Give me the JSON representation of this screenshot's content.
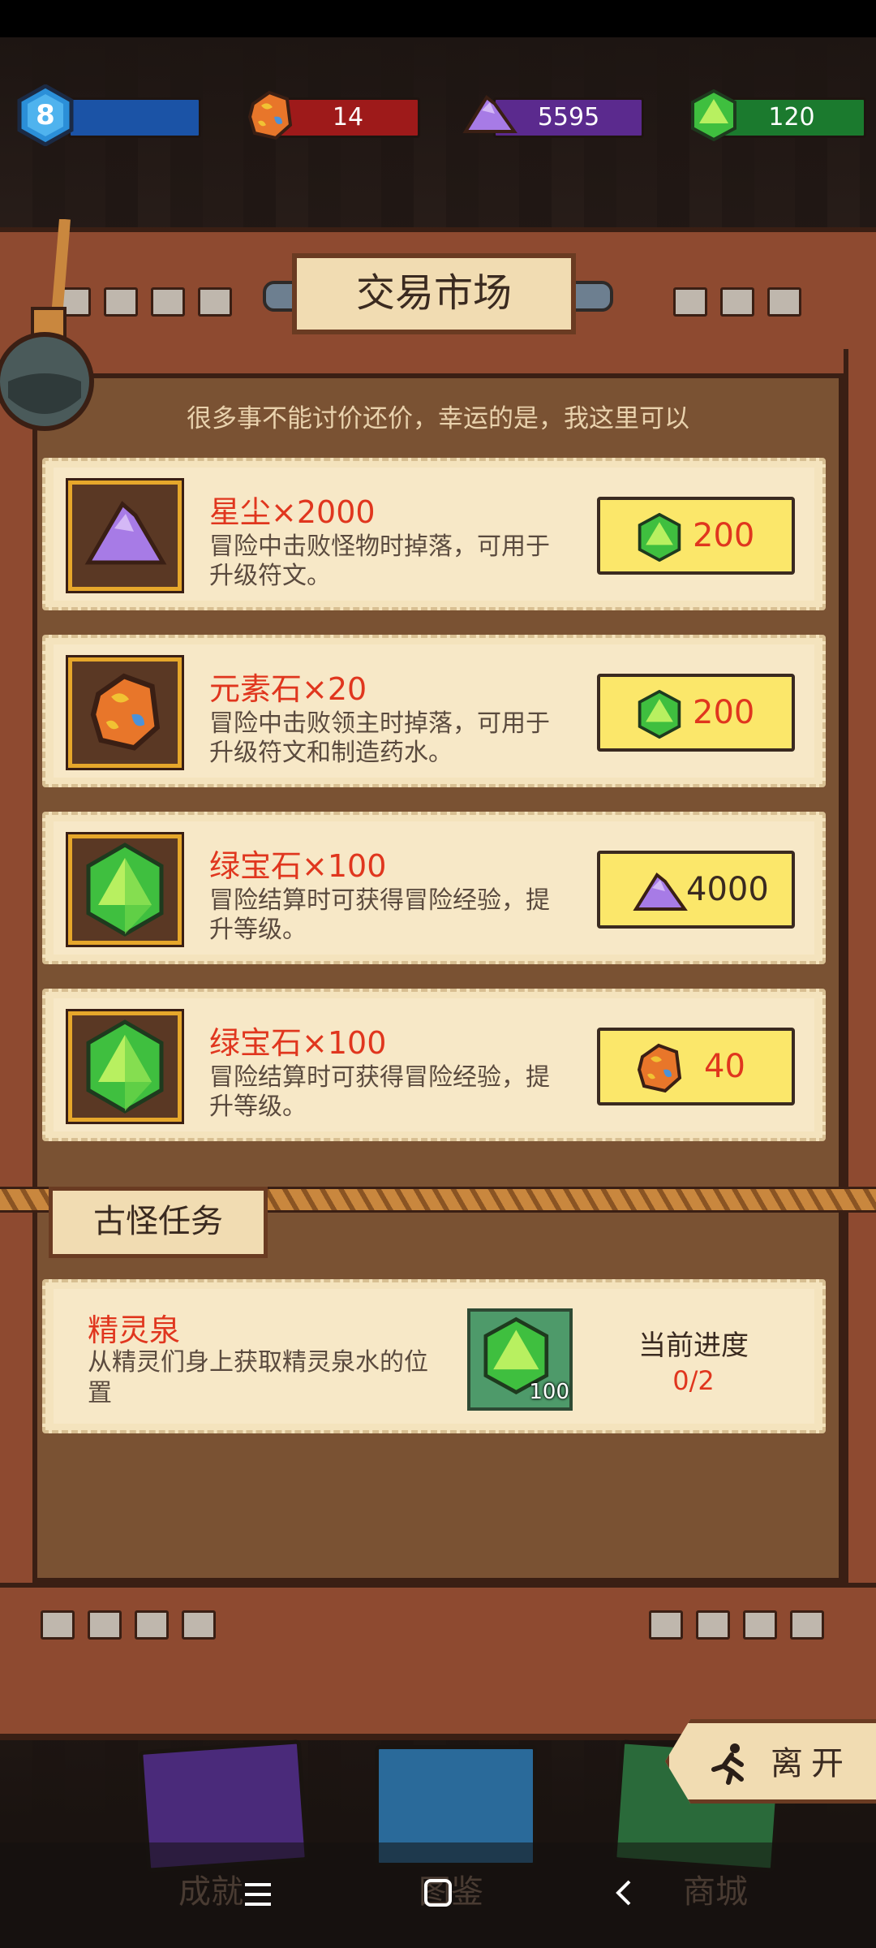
{
  "top_bar": {
    "level": "8",
    "element_stones": "14",
    "stardust": "5595",
    "emeralds": "120"
  },
  "market": {
    "title": "交易市场",
    "subtitle": "很多事不能讨价还价，幸运的是，我这里可以",
    "items": [
      {
        "name": "星尘×2000",
        "desc_1": "冒险中击败怪物时掉落，可用于",
        "desc_2": "升级符文。",
        "price": "200"
      },
      {
        "name": "元素石×20",
        "desc_1": "冒险中击败领主时掉落，可用于",
        "desc_2": "升级符文和制造药水。",
        "price": "200"
      },
      {
        "name": "绿宝石×100",
        "desc_1": "冒险结算时可获得冒险经验，提",
        "desc_2": "升等级。",
        "price": "4000"
      },
      {
        "name": "绿宝石×100",
        "desc_1": "冒险结算时可获得冒险经验，提",
        "desc_2": "升等级。",
        "price": "40"
      }
    ]
  },
  "quests": {
    "header": "古怪任务",
    "quest": {
      "name": "精灵泉",
      "desc_1": "从精灵们身上获取精灵泉水的位",
      "desc_2": "置",
      "reward_count": "100",
      "progress_label": "当前进度",
      "progress_value": "0/2"
    }
  },
  "leave_label": "离开",
  "dock": {
    "achievements": "成就",
    "codex": "图鉴",
    "shop": "商城"
  },
  "colors": {
    "accent_red": "#e0361e",
    "button_yellow": "#fbe76a",
    "card_bg": "#f4e3bd",
    "frame_brown": "#8e4a30"
  }
}
